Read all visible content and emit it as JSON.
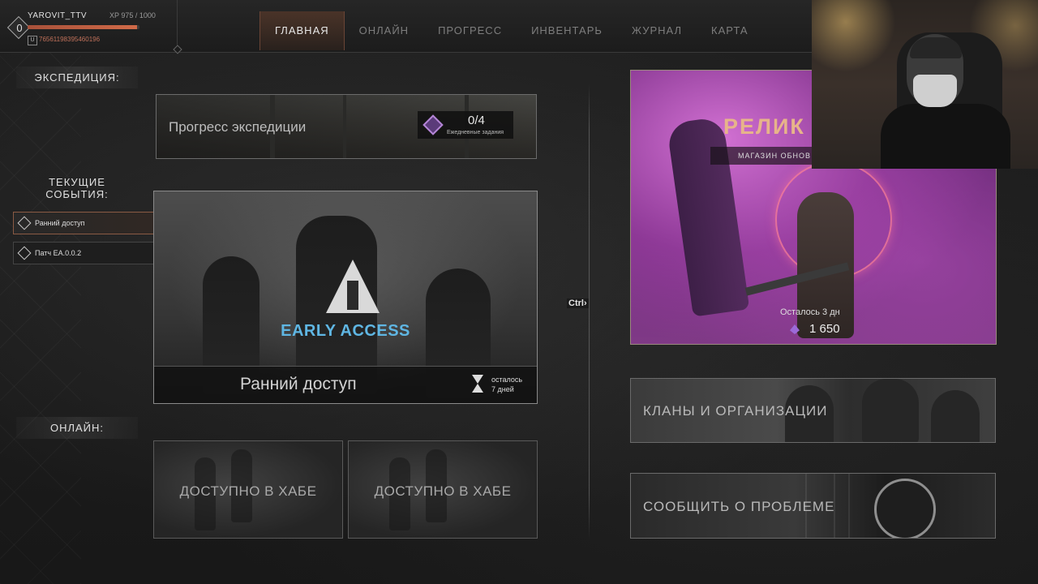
{
  "player": {
    "level": "0",
    "name": "YAROVIT_TTV",
    "xp_label": "XP",
    "xp_text": "975 / 1000",
    "xp_fraction": 0.975,
    "id_badge": "U",
    "id": "76561198395460196"
  },
  "nav": {
    "tabs": [
      {
        "label": "ГЛАВНАЯ",
        "active": true
      },
      {
        "label": "ОНЛАЙН",
        "active": false
      },
      {
        "label": "ПРОГРЕСС",
        "active": false
      },
      {
        "label": "ИНВЕНТАРЬ",
        "active": false
      },
      {
        "label": "ЖУРНАЛ",
        "active": false
      },
      {
        "label": "КАРТА",
        "active": false
      }
    ]
  },
  "sections": {
    "expedition": "ЭКСПЕДИЦИЯ:",
    "events": "ТЕКУЩИЕ СОБЫТИЯ:",
    "online": "ОНЛАЙН:"
  },
  "expedition": {
    "title": "Прогресс экспедиции",
    "count": "0/4",
    "subtitle": "Ежедневные задания"
  },
  "events": {
    "items": [
      {
        "label": "Ранний доступ",
        "active": true
      },
      {
        "label": "Патч EA.0.0.2",
        "active": false
      }
    ]
  },
  "early_access": {
    "banner": "EARLY ACCESS",
    "title": "Ранний доступ",
    "remain_line1": "осталось",
    "remain_line2": "7 дней"
  },
  "online": {
    "cards": [
      {
        "label": "ДОСТУПНО В ХАБЕ"
      },
      {
        "label": "ДОСТУПНО В ХАБЕ"
      }
    ]
  },
  "ctrl_hint": "Ctrl›",
  "relic": {
    "title": "РЕЛИК",
    "subtitle": "МАГАЗИН ОБНОВ",
    "timer": "Осталось 3 дн",
    "price": "1 650"
  },
  "clans": {
    "label": "КЛАНЫ И ОРГАНИЗАЦИИ"
  },
  "report": {
    "label": "СООБЩИТЬ О ПРОБЛЕМЕ"
  },
  "colors": {
    "accent": "#c0715a",
    "ea_blue": "#5fb6e3",
    "relic_gold": "#e7b48a",
    "crystal": "#9c6ad8"
  }
}
